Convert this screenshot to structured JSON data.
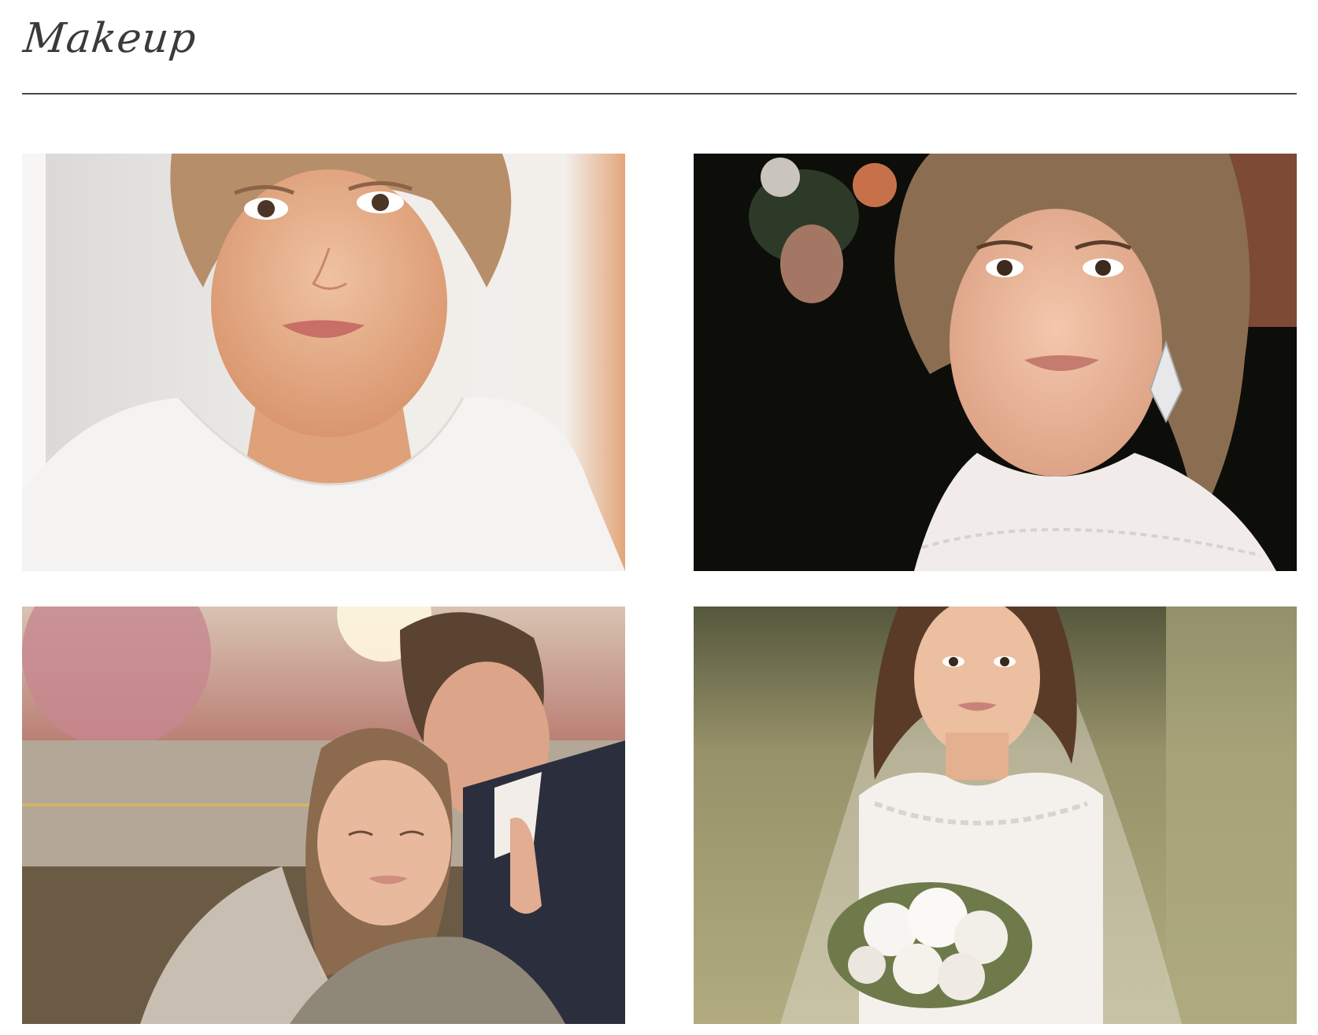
{
  "header": {
    "title": "Makeup"
  },
  "gallery": {
    "photos": [
      {
        "name": "bride-portrait-white-dress",
        "palette": {
          "bg": "#e9e6e3",
          "accent": "#e2a67a",
          "skin": "#e7b592",
          "hair": "#b78e6a",
          "garment": "#f5f3f1"
        }
      },
      {
        "name": "bride-curly-hair-earring",
        "palette": {
          "bg": "#0f0f0c",
          "accent": "#c7714a",
          "skin": "#e9b79a",
          "hair": "#8b6e51",
          "garment": "#f1ecea"
        }
      },
      {
        "name": "couple-embrace-sunset",
        "palette": {
          "bg": "#b7a08b",
          "accent": "#c78790",
          "skin": "#e5b298",
          "hair": "#5b4331",
          "garment": "#2b2f3d"
        }
      },
      {
        "name": "bride-veil-bouquet",
        "palette": {
          "bg": "#a8a27a",
          "accent": "#6f7a4a",
          "skin": "#ebbf9f",
          "hair": "#5a3b28",
          "garment": "#f4f1ed"
        }
      }
    ]
  }
}
